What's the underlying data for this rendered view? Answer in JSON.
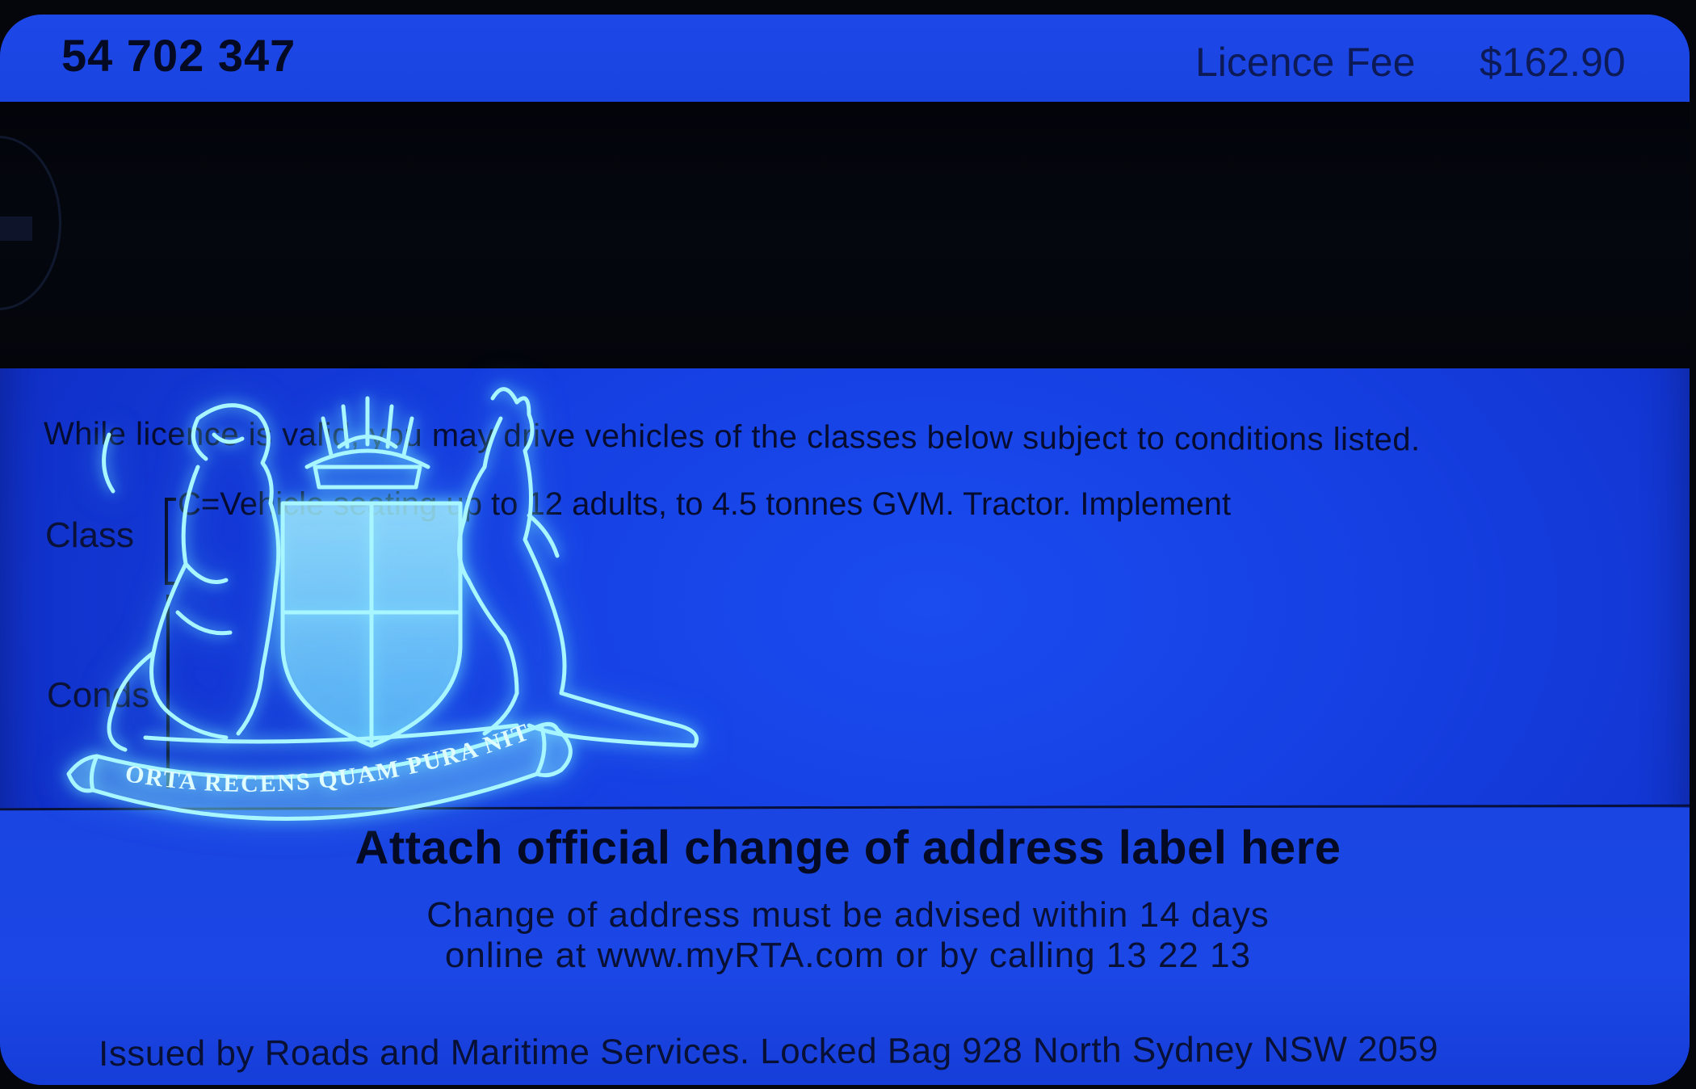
{
  "card": {
    "number": "54 702 347",
    "fee_label": "Licence Fee",
    "fee_value": "$162.90",
    "intro": "While licence is valid, you may drive vehicles of the classes below subject to conditions listed.",
    "class_label": "Class",
    "class_text": "C=Vehicle seating up to 12 adults, to 4.5 tonnes GVM. Tractor. Implement",
    "conds_label": "Conds",
    "attach_title": "Attach official change of address label here",
    "advice_line1": "Change of address must be advised within 14 days",
    "advice_line2": "online at www.myRTA.com or by calling 13 22 13",
    "issuer": "Issued by Roads and Maritime Services. Locked Bag 928 North Sydney NSW 2059"
  },
  "crest": {
    "motto": "ORTA RECENS QUAM PURA NITES",
    "glow_color": "#7ef0ff"
  },
  "colors": {
    "card_blue": "#1a44e0",
    "stripe": "#03050b",
    "ink": "#060c30"
  }
}
